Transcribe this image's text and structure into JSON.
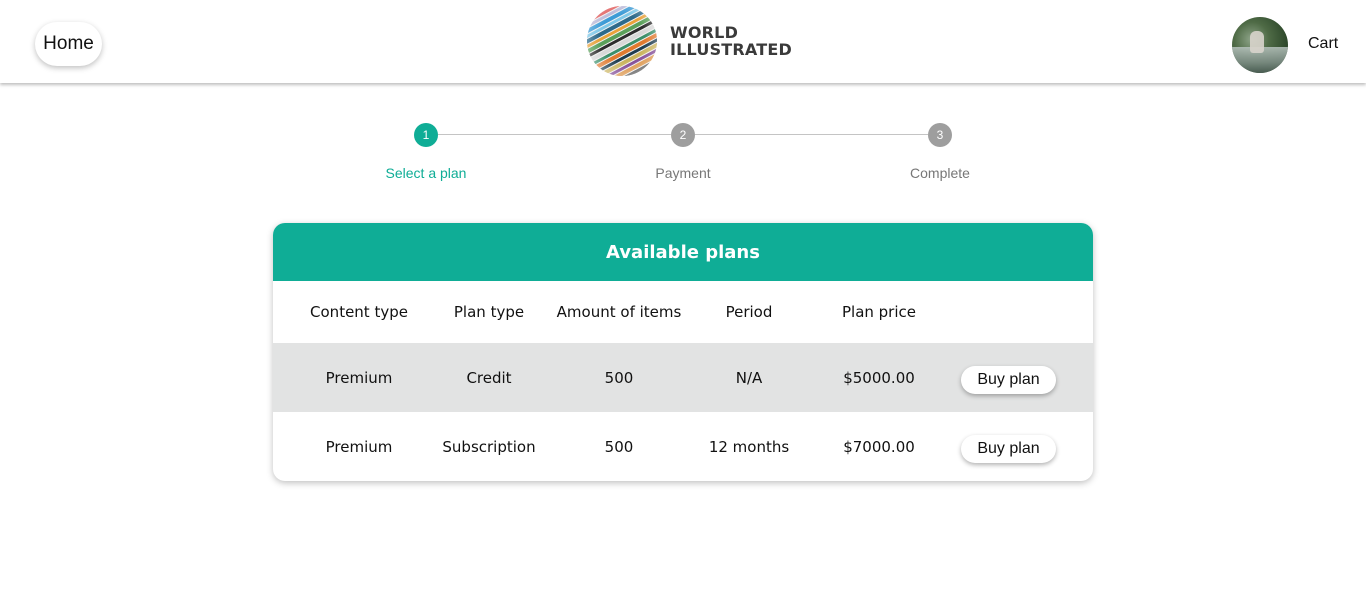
{
  "colors": {
    "accent": "#0fad96",
    "inactive_step": "#9e9e9e",
    "row_shade": "#e2e3e3"
  },
  "header": {
    "home_label": "Home",
    "logo": {
      "line1": "WORLD",
      "line2": "ILLUSTRATED"
    },
    "cart_label": "Cart"
  },
  "stepper": {
    "steps": [
      {
        "number": "1",
        "label": "Select a plan",
        "active": true
      },
      {
        "number": "2",
        "label": "Payment",
        "active": false
      },
      {
        "number": "3",
        "label": "Complete",
        "active": false
      }
    ]
  },
  "plans": {
    "title": "Available plans",
    "columns": [
      "Content type",
      "Plan type",
      "Amount of items",
      "Period",
      "Plan price"
    ],
    "rows": [
      {
        "content_type": "Premium",
        "plan_type": "Credit",
        "amount": "500",
        "period": "N/A",
        "price": "$5000.00",
        "action": "Buy plan"
      },
      {
        "content_type": "Premium",
        "plan_type": "Subscription",
        "amount": "500",
        "period": "12 months",
        "price": "$7000.00",
        "action": "Buy plan"
      }
    ]
  }
}
